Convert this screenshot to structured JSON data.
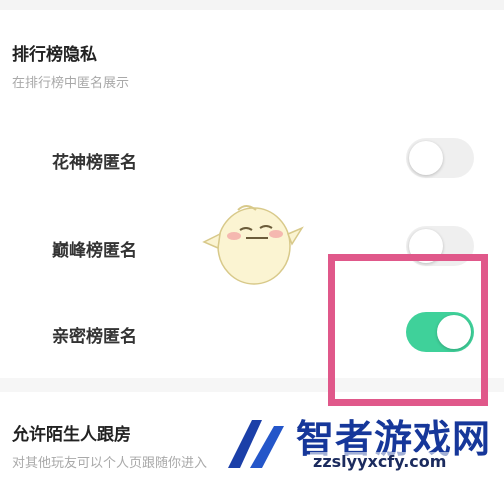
{
  "privacy": {
    "title": "排行榜隐私",
    "subtitle": "在排行榜中匿名展示",
    "rows": [
      {
        "label": "花神榜匿名",
        "enabled": false
      },
      {
        "label": "巅峰榜匿名",
        "enabled": false
      },
      {
        "label": "亲密榜匿名",
        "enabled": true
      }
    ]
  },
  "stranger": {
    "title": "允许陌生人跟房",
    "subtitle": "对其他玩友可以个人页跟随你进入"
  },
  "watermark": {
    "text": "智者游戏网",
    "url": "zzslyyxcfy.com"
  },
  "colors": {
    "toggle_on": "#3fd19a",
    "toggle_off": "#efefef",
    "highlight_border": "#e0588a",
    "watermark_blue": "#16379a"
  }
}
